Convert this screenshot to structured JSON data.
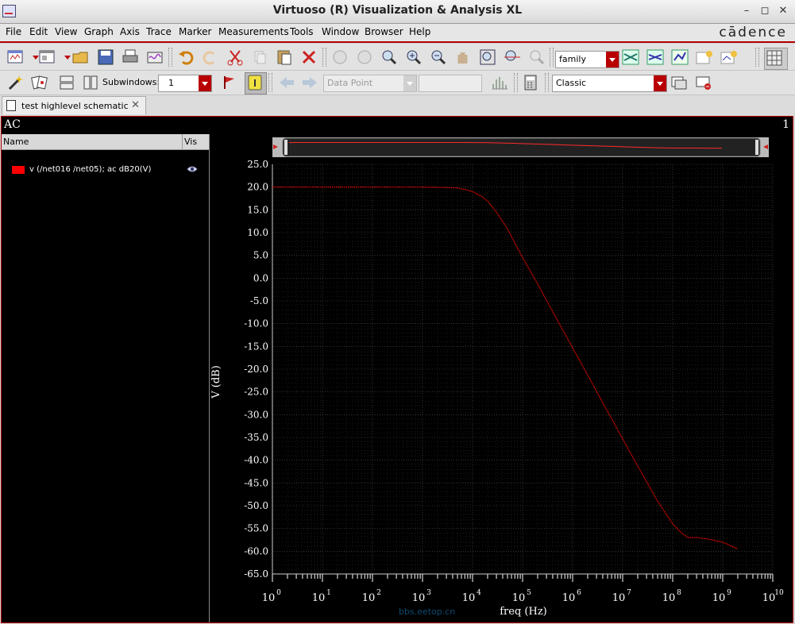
{
  "window": {
    "title": "Virtuoso (R) Visualization & Analysis XL"
  },
  "menubar": {
    "items": [
      "File",
      "Edit",
      "View",
      "Graph",
      "Axis",
      "Trace",
      "Marker",
      "Measurements",
      "Tools",
      "Window",
      "Browser",
      "Help"
    ],
    "brand": "cādence"
  },
  "toolbar1": {
    "family_combo": "family"
  },
  "toolbar2": {
    "subwindows_label": "Subwindows:",
    "subwindows_value": "1",
    "datapoint_combo": "Data Point",
    "style_combo": "Classic"
  },
  "tabs": [
    {
      "label": "test highlevel schematic"
    }
  ],
  "subwindow": {
    "name": "AC",
    "index": "1"
  },
  "legend": {
    "col_name": "Name",
    "col_vis": "Vis",
    "traces": [
      {
        "label": "v (/net016 /net05); ac dB20(V)",
        "color": "#ff0000",
        "visible": true
      }
    ]
  },
  "watermark": "bbs.eetop.cn",
  "chart_data": {
    "type": "line",
    "xlabel": "freq (Hz)",
    "ylabel": "V (dB)",
    "xscale": "log",
    "xlim": [
      1,
      10000000000
    ],
    "ylim": [
      -65,
      25
    ],
    "yticks": [
      "25.0",
      "20.0",
      "15.0",
      "10.0",
      "5.0",
      "0.0",
      "-5.0",
      "-10.0",
      "-15.0",
      "-20.0",
      "-25.0",
      "-30.0",
      "-35.0",
      "-40.0",
      "-45.0",
      "-50.0",
      "-55.0",
      "-60.0",
      "-65.0"
    ],
    "xtick_exponents": [
      "0",
      "1",
      "2",
      "3",
      "4",
      "5",
      "6",
      "7",
      "8",
      "9",
      "10"
    ],
    "grid": true,
    "series": [
      {
        "name": "v (/net016 /net05); ac dB20(V)",
        "color": "#ff0000",
        "x": [
          1,
          10,
          100,
          1000,
          3000,
          5000,
          7000,
          10000,
          15000,
          20000,
          30000,
          50000,
          100000,
          200000,
          500000,
          1000000,
          2000000,
          5000000,
          10000000,
          20000000,
          50000000,
          100000000,
          150000000,
          200000000,
          300000000,
          500000000,
          1000000000,
          2000000000
        ],
        "y": [
          20.0,
          20.0,
          20.0,
          20.0,
          19.9,
          19.8,
          19.5,
          19.0,
          18.0,
          16.9,
          14.5,
          10.8,
          4.5,
          -1.3,
          -9.3,
          -15.3,
          -21.3,
          -29.3,
          -35.3,
          -41.3,
          -49.0,
          -54.0,
          -56.0,
          -57.0,
          -57.0,
          -57.3,
          -58.0,
          -59.5
        ]
      }
    ]
  }
}
